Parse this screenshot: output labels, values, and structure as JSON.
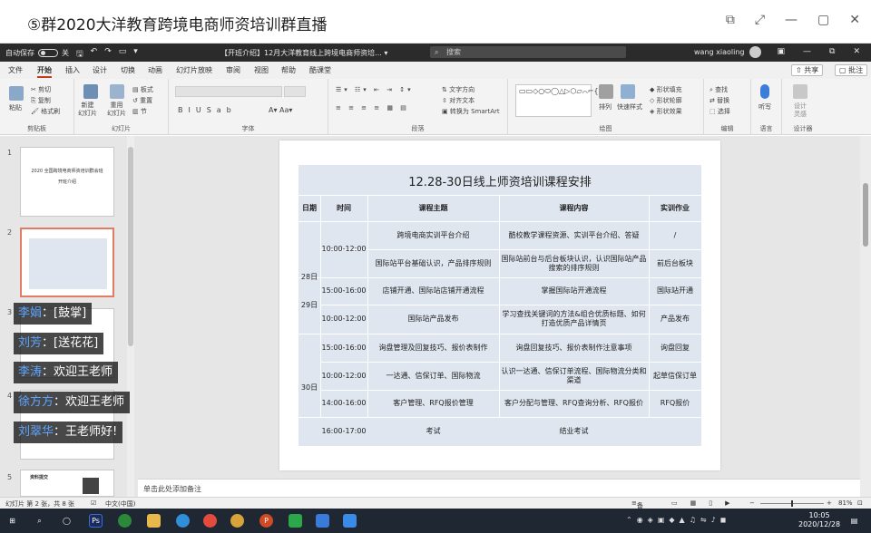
{
  "window": {
    "title": "⑤群2020大洋教育跨境电商师资培训群直播"
  },
  "ppt": {
    "autosave_label": "自动保存",
    "toggle_state": "关",
    "doc_title": "【开班介绍】12月大洋教育线上跨境电商师资培... ▾",
    "search_placeholder": "搜索",
    "user_name": "wang xiaoling",
    "tabs": [
      "文件",
      "开始",
      "插入",
      "设计",
      "切换",
      "动画",
      "幻灯片放映",
      "审阅",
      "视图",
      "帮助",
      "酷课堂"
    ],
    "active_tab": 1,
    "share_label": "共享",
    "comment_label": "批注"
  },
  "ribbon": {
    "groups": [
      "剪贴板",
      "幻灯片",
      "字体",
      "段落",
      "绘图",
      "编辑",
      "语言",
      "设计器"
    ],
    "paste": "粘贴",
    "cut": "剪切",
    "copy": "复制",
    "format_painter": "格式刷",
    "new_slide": "新建\n幻灯片",
    "reuse_slide": "重用\n幻灯片",
    "layout": "板式",
    "reset": "重置",
    "section": "节",
    "text_direction": "文字方向",
    "align_text": "对齐文本",
    "smartart": "转换为 SmartArt",
    "arrange": "排列",
    "quick_styles": "快速样式",
    "shape_fill": "形状填充",
    "shape_outline": "形状轮廓",
    "shape_effects": "形状效果",
    "find": "查找",
    "replace": "替换",
    "select": "选择",
    "dictate": "听写",
    "design_ideas": "设计\n灵感"
  },
  "slides_pane": {
    "numbers": [
      "1",
      "2",
      "3",
      "4",
      "5"
    ],
    "slide1_title": "2020 全国跨境电商师资培训群会班",
    "slide1_sub": "开班介绍",
    "slide5_title": "资料提交"
  },
  "slide": {
    "title": "12.28-30日线上师资培训课程安排",
    "headers": [
      "日期",
      "时间",
      "课程主题",
      "课程内容",
      "实训作业"
    ],
    "rows": [
      {
        "topic": "跨境电商实训平台介绍",
        "content": "酷校教学课程资源、实训平台介绍、答疑",
        "hw": "/"
      },
      {
        "topic": "国际站平台基础认识，产品排序规则",
        "content": "国际站前台与后台板块认识，认识国际站产品搜索的排序规则",
        "hw": "前后台板块"
      },
      {
        "time": "15:00-16:00",
        "topic": "店铺开通、国际站店铺开通流程",
        "content": "掌握国际站开通流程",
        "hw": "国际站开通"
      },
      {
        "time": "10:00-12:00",
        "topic": "国际站产品发布",
        "content": "学习查找关键词的方法&组合优质标题、如何打造优质产品详情页",
        "hw": "产品发布"
      },
      {
        "time": "15:00-16:00",
        "topic": "询盘管理及回复技巧、报价表制作",
        "content": "询盘回复技巧、报价表制作注意事项",
        "hw": "询盘回复"
      },
      {
        "time": "10:00-12:00",
        "topic": "一达通、信保订单、国际物流",
        "content": "认识一达通、信保订单流程、国际物流分类和渠道",
        "hw": "起草信保订单"
      },
      {
        "time": "14:00-16:00",
        "topic": "客户管理、RFQ报价管理",
        "content": "客户分配与管理、RFQ查询分析、RFQ报价",
        "hw": "RFQ报价"
      },
      {
        "time": "16:00-17:00",
        "topic": "考试",
        "content": "结业考试",
        "hw": ""
      }
    ],
    "first_time": "10:00-12:00",
    "dates": [
      "28日",
      "29日",
      "30日"
    ]
  },
  "notes_placeholder": "单击此处添加备注",
  "status": {
    "slide_count": "幻灯片 第 2 张，共 8 张",
    "language": "中文(中国)",
    "notes_btn": "备注",
    "zoom": "81%"
  },
  "taskbar": {
    "time": "10:05",
    "date": "2020/12/28"
  },
  "chat": [
    {
      "name": "李娟",
      "msg": "[鼓掌]"
    },
    {
      "name": "刘芳",
      "msg": "[送花花]"
    },
    {
      "name": "李涛",
      "msg": "欢迎王老师"
    },
    {
      "name": "徐方方",
      "msg": "欢迎王老师"
    },
    {
      "name": "刘翠华",
      "msg": "王老师好!"
    }
  ],
  "colors": {
    "accent": "#c43e1c",
    "chat_name": "#5da5ff",
    "table_bg": "#dfe6f0"
  }
}
